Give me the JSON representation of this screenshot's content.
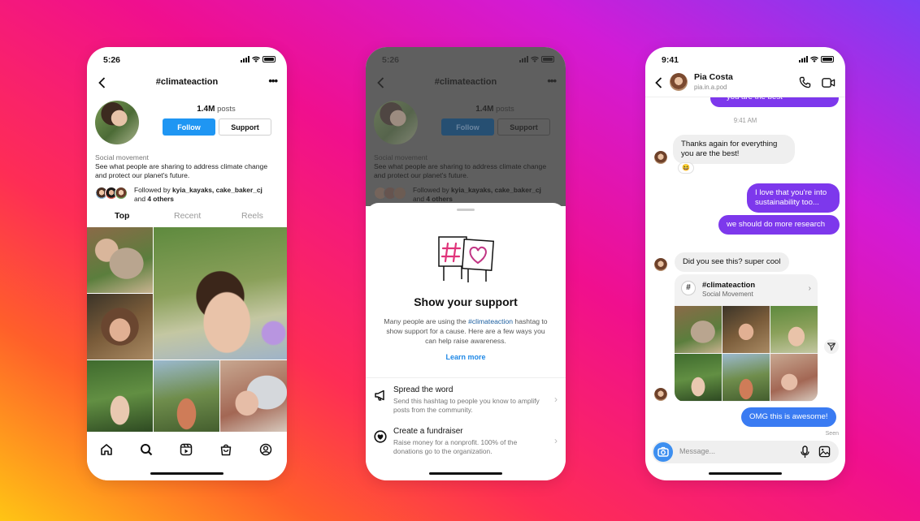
{
  "colors": {
    "follow_blue": "#1f96f3",
    "message_purple": "#7d38ec",
    "message_blue": "#3a7bf2",
    "link_blue": "#1f88e6"
  },
  "phone1": {
    "status_time": "5:26",
    "title": "#climateaction",
    "more_icon": "more-dots-icon",
    "stats_count": "1.4M",
    "stats_label": " posts",
    "follow_label": "Follow",
    "support_label": "Support",
    "category": "Social movement",
    "description": "See what people are sharing to address climate change and protect our planet's future.",
    "followed_prefix": "Followed by ",
    "followed_names": "kyia_kayaks, cake_baker_cj",
    "followed_and": "and ",
    "followed_others": "4 others",
    "tabs": [
      "Top",
      "Recent",
      "Reels"
    ],
    "nav_icons": [
      "home-icon",
      "search-icon",
      "reels-icon",
      "shop-icon",
      "profile-icon"
    ]
  },
  "phone2": {
    "status_time": "5:26",
    "title": "#climateaction",
    "stats_count": "1.4M",
    "stats_label": " posts",
    "follow_label": "Follow",
    "support_label": "Support",
    "category": "Social movement",
    "description": "See what people are sharing to address climate change and protect our planet's future.",
    "followed_prefix": "Followed by ",
    "followed_names": "kyia_kayaks, cake_baker_cj",
    "followed_and": "and ",
    "followed_others": "4 others",
    "sheet_title": "Show your support",
    "sheet_desc_pre": "Many people are using the ",
    "sheet_desc_tag": "#climateaction",
    "sheet_desc_post": " hashtag to show support for a cause. Here are a few ways you can help raise awareness.",
    "learn_more": "Learn more",
    "options": [
      {
        "title": "Spread the word",
        "desc": "Send this hashtag to people you know to amplify posts from the community."
      },
      {
        "title": "Create a fundraiser",
        "desc": "Raise money for a nonprofit. 100% of the donations go to the organization."
      }
    ]
  },
  "phone3": {
    "status_time": "9:41",
    "name": "Pia Costa",
    "username": "pia.in.a.pod",
    "partial_msg": "you are the best",
    "timestamp": "9:41 AM",
    "msg1": "Thanks again for everything you are the best!",
    "reaction": "😆",
    "msg2": "I love that you're into sustainability too...",
    "msg3": "we should do more research",
    "msg4": "Did you see this? super cool",
    "card_title": "#climateaction",
    "card_sub": "Social Movement",
    "msg5": "OMG this is awesome!",
    "seen": "Seen",
    "composer_placeholder": "Message..."
  }
}
